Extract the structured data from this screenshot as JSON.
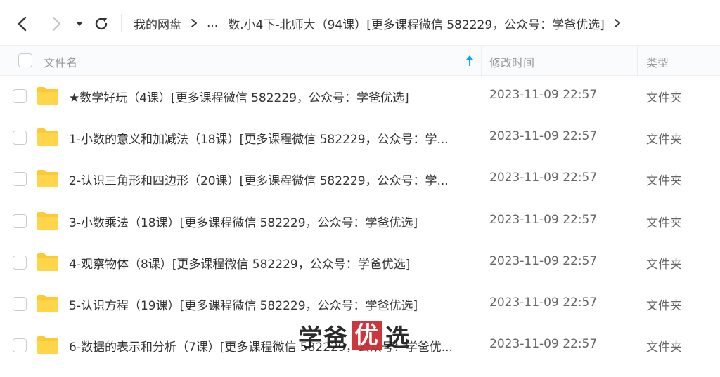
{
  "nav": {
    "back_icon": "chevron-left-icon",
    "forward_icon": "chevron-right-icon",
    "dropdown_icon": "caret-down-icon",
    "refresh_icon": "refresh-icon"
  },
  "breadcrumb": {
    "root": "我的网盘",
    "ellipsis": "...",
    "current": "数.小4下-北师大（94课）[更多课程微信 582229，公众号：学爸优选]"
  },
  "header": {
    "name": "文件名",
    "modified": "修改时间",
    "type": "类型",
    "sort_icon": "sort-ascending-icon"
  },
  "files": [
    {
      "name": "★数学好玩（4课）[更多课程微信 582229，公众号：学爸优选]",
      "modified": "2023-11-09 22:57",
      "type": "文件夹"
    },
    {
      "name": "1-小数的意义和加减法（18课）[更多课程微信 582229，公众号：学...",
      "modified": "2023-11-09 22:57",
      "type": "文件夹"
    },
    {
      "name": "2-认识三角形和四边形（20课）[更多课程微信 582229，公众号：学...",
      "modified": "2023-11-09 22:57",
      "type": "文件夹"
    },
    {
      "name": "3-小数乘法（18课）[更多课程微信 582229，公众号：学爸优选]",
      "modified": "2023-11-09 22:57",
      "type": "文件夹"
    },
    {
      "name": "4-观察物体（8课）[更多课程微信 582229，公众号：学爸优选]",
      "modified": "2023-11-09 22:57",
      "type": "文件夹"
    },
    {
      "name": "5-认识方程（19课）[更多课程微信 582229，公众号：学爸优选]",
      "modified": "2023-11-09 22:57",
      "type": "文件夹"
    },
    {
      "name": "6-数据的表示和分析（7课）[更多课程微信 582229，公众号：学爸优...",
      "modified": "2023-11-09 22:57",
      "type": "文件夹"
    }
  ],
  "watermark": {
    "part1": "学爸",
    "highlight": "优",
    "part2": "选"
  },
  "colors": {
    "folder": "#ffc933",
    "accent": "#06a7ff",
    "watermark_box": "#c8272e"
  }
}
